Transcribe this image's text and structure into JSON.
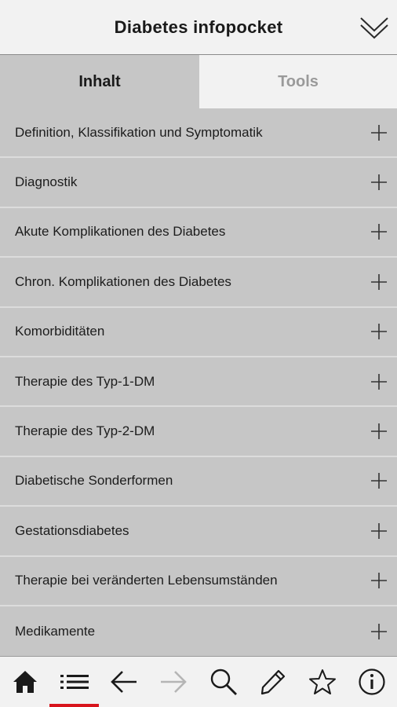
{
  "header": {
    "title": "Diabetes infopocket"
  },
  "tabs": [
    {
      "label": "Inhalt",
      "active": true
    },
    {
      "label": "Tools",
      "active": false
    }
  ],
  "list": {
    "items": [
      {
        "label": "Definition, Klassifikation und Symptomatik"
      },
      {
        "label": "Diagnostik"
      },
      {
        "label": "Akute Komplikationen des Diabetes"
      },
      {
        "label": "Chron. Komplikationen des Diabetes"
      },
      {
        "label": "Komorbiditäten"
      },
      {
        "label": "Therapie des Typ-1-DM"
      },
      {
        "label": "Therapie des Typ-2-DM"
      },
      {
        "label": "Diabetische Sonderformen"
      },
      {
        "label": "Gestationsdiabetes"
      },
      {
        "label": "Therapie bei veränderten Lebensumständen"
      },
      {
        "label": "Medikamente"
      }
    ]
  },
  "bottom_nav": {
    "items": [
      {
        "icon": "home-icon"
      },
      {
        "icon": "list-icon",
        "active": true
      },
      {
        "icon": "back-arrow-icon"
      },
      {
        "icon": "forward-arrow-icon",
        "disabled": true
      },
      {
        "icon": "search-icon"
      },
      {
        "icon": "pencil-icon"
      },
      {
        "icon": "star-icon"
      },
      {
        "icon": "info-icon"
      }
    ]
  },
  "colors": {
    "accent": "#d8141c",
    "list_background": "#c6c6c6",
    "header_background": "#f2f2f2"
  }
}
